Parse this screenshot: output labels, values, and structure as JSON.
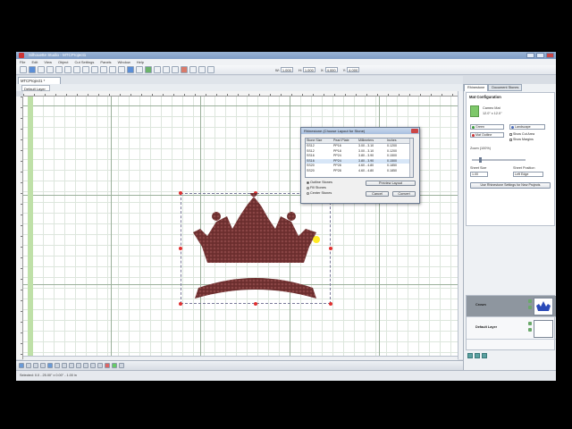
{
  "window": {
    "title": "Silhouette Studio - MTCProject1"
  },
  "menu": [
    "File",
    "Edit",
    "View",
    "Object",
    "Cut Settings",
    "Panels",
    "Window",
    "Help"
  ],
  "coords": [
    {
      "label": "W:",
      "value": "1.000"
    },
    {
      "label": "H:",
      "value": "1.000"
    },
    {
      "label": "X:",
      "value": "4.000"
    },
    {
      "label": "Y:",
      "value": "4.000"
    }
  ],
  "doc_tab": "MTCProject1 *",
  "sub_tab": "Default Layer",
  "dialog": {
    "title": "Rhinestone (Choose Layout for Stone)",
    "headers": [
      "Stone Size",
      "Pearl Plate",
      "Millimeters",
      "Inches"
    ],
    "rows": [
      [
        "SS12",
        "PP16",
        "3.00 - 3.10",
        "0.1200"
      ],
      [
        "SS12",
        "PP18",
        "3.00 - 3.10",
        "0.1200"
      ],
      [
        "SS16",
        "PP24",
        "3.80 - 3.90",
        "0.1500"
      ],
      [
        "SS16",
        "PP24",
        "3.80 - 3.90",
        "0.1500"
      ],
      [
        "SS20",
        "PP28",
        "4.60 - 4.80",
        "0.1850"
      ],
      [
        "SS20",
        "PP28",
        "4.60 - 4.80",
        "0.1850"
      ]
    ],
    "selected_row": 3,
    "radios": [
      "Outline Stones",
      "Fill Stones",
      "Center Stones"
    ],
    "buttons": {
      "primary": "Preview Layout",
      "cancel": "Cancel",
      "apply": "Convert"
    }
  },
  "panel": {
    "tabs": [
      "Rhinestone",
      "Document Stones"
    ],
    "section_title": "Mat Configuration",
    "mat_name": "Cameo Mat",
    "mat_size": "12.0\" x 12.0\"",
    "color_label": "Green",
    "orientation_label": "Landscape",
    "outline_label": "Mat Outline",
    "show_grid_label": "Show Cut Area",
    "show_margin_label": "Show Margins",
    "zoom_label": "Zoom (100%)",
    "sheet_label": "Sheet Size",
    "sheet_value": "1.00",
    "hold_label": "Sheet Position",
    "hold_value": "Left Edge",
    "button": "Use Rhinestone Settings for New Projects"
  },
  "layers": [
    {
      "name": "Crown"
    },
    {
      "name": "Default Layer"
    }
  ],
  "status": "Selected: 0.0 - 25.00\" x 0.00\" - 1.00 in",
  "colors": {
    "crown": "#6b2e2e",
    "accent": "#4a7ab8",
    "handle": "#e03030"
  }
}
